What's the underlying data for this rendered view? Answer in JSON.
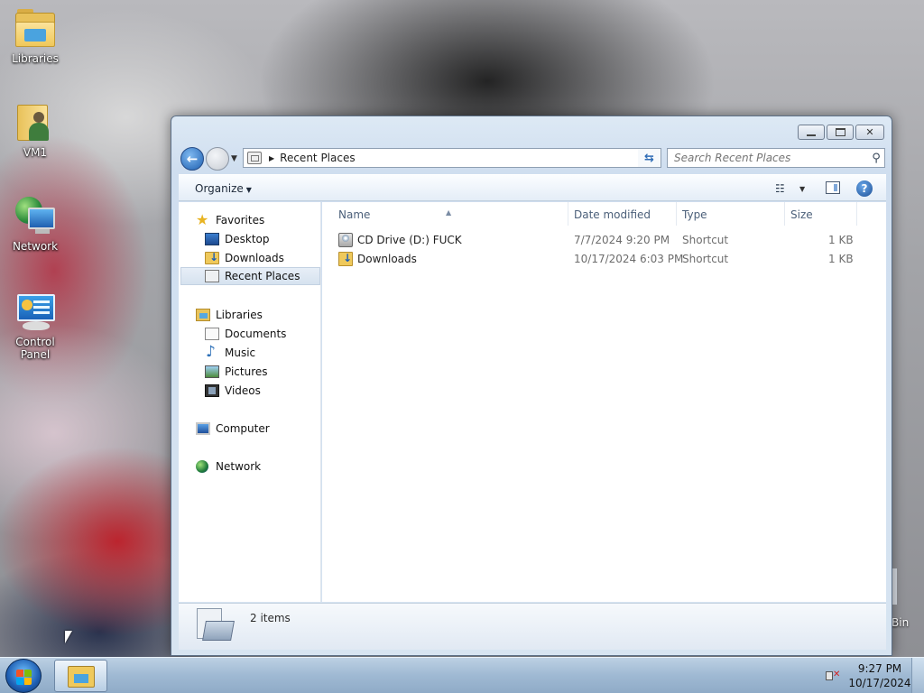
{
  "desktop": {
    "icons": [
      {
        "label": "Libraries",
        "icon": "libraries-icon"
      },
      {
        "label": "VM1",
        "icon": "user-folder-icon"
      },
      {
        "label": "Network",
        "icon": "network-icon"
      },
      {
        "label": "Control Panel",
        "icon": "control-panel-icon"
      }
    ],
    "recycle_bin_partial_label": "Bin"
  },
  "window": {
    "address": {
      "location": "Recent Places"
    },
    "search": {
      "placeholder": "Search Recent Places"
    },
    "toolbar": {
      "organize_label": "Organize"
    },
    "nav_pane": {
      "favorites_header": "Favorites",
      "favorites": [
        "Desktop",
        "Downloads",
        "Recent Places"
      ],
      "libraries_header": "Libraries",
      "libraries": [
        "Documents",
        "Music",
        "Pictures",
        "Videos"
      ],
      "computer": "Computer",
      "network": "Network",
      "selected": "Recent Places"
    },
    "columns": {
      "name": "Name",
      "date_modified": "Date modified",
      "type": "Type",
      "size": "Size"
    },
    "files": [
      {
        "name": "CD Drive (D:) FUCK",
        "date_modified": "7/7/2024 9:20 PM",
        "type": "Shortcut",
        "size": "1 KB",
        "icon": "cd-drive-icon"
      },
      {
        "name": "Downloads",
        "date_modified": "10/17/2024 6:03 PM",
        "type": "Shortcut",
        "size": "1 KB",
        "icon": "downloads-folder-icon"
      }
    ],
    "details": {
      "item_count": "2 items"
    }
  },
  "taskbar": {
    "clock_time": "9:27 PM",
    "clock_date": "10/17/2024",
    "volume_state": "muted"
  }
}
